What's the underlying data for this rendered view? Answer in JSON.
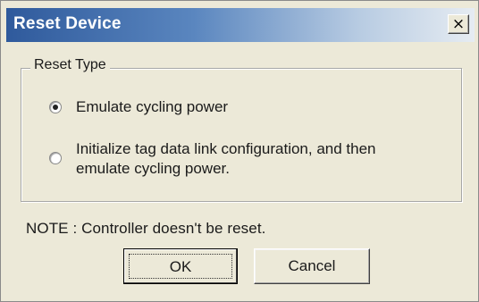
{
  "dialog": {
    "title": "Reset Device",
    "close_glyph": "×",
    "close_icon": "close-icon"
  },
  "reset_type": {
    "group_label": "Reset Type",
    "options": [
      {
        "label": "Emulate cycling power",
        "checked": true
      },
      {
        "label": "Initialize tag data link configuration, and then",
        "label_line2": "emulate cycling power.",
        "checked": false
      }
    ]
  },
  "note": "NOTE : Controller doesn't be reset.",
  "buttons": {
    "ok_label": "OK",
    "cancel_label": "Cancel"
  },
  "colors": {
    "titlebar_start": "#2f5a9c",
    "titlebar_end": "#e6ecf2",
    "dialog_bg": "#ece9d8"
  }
}
